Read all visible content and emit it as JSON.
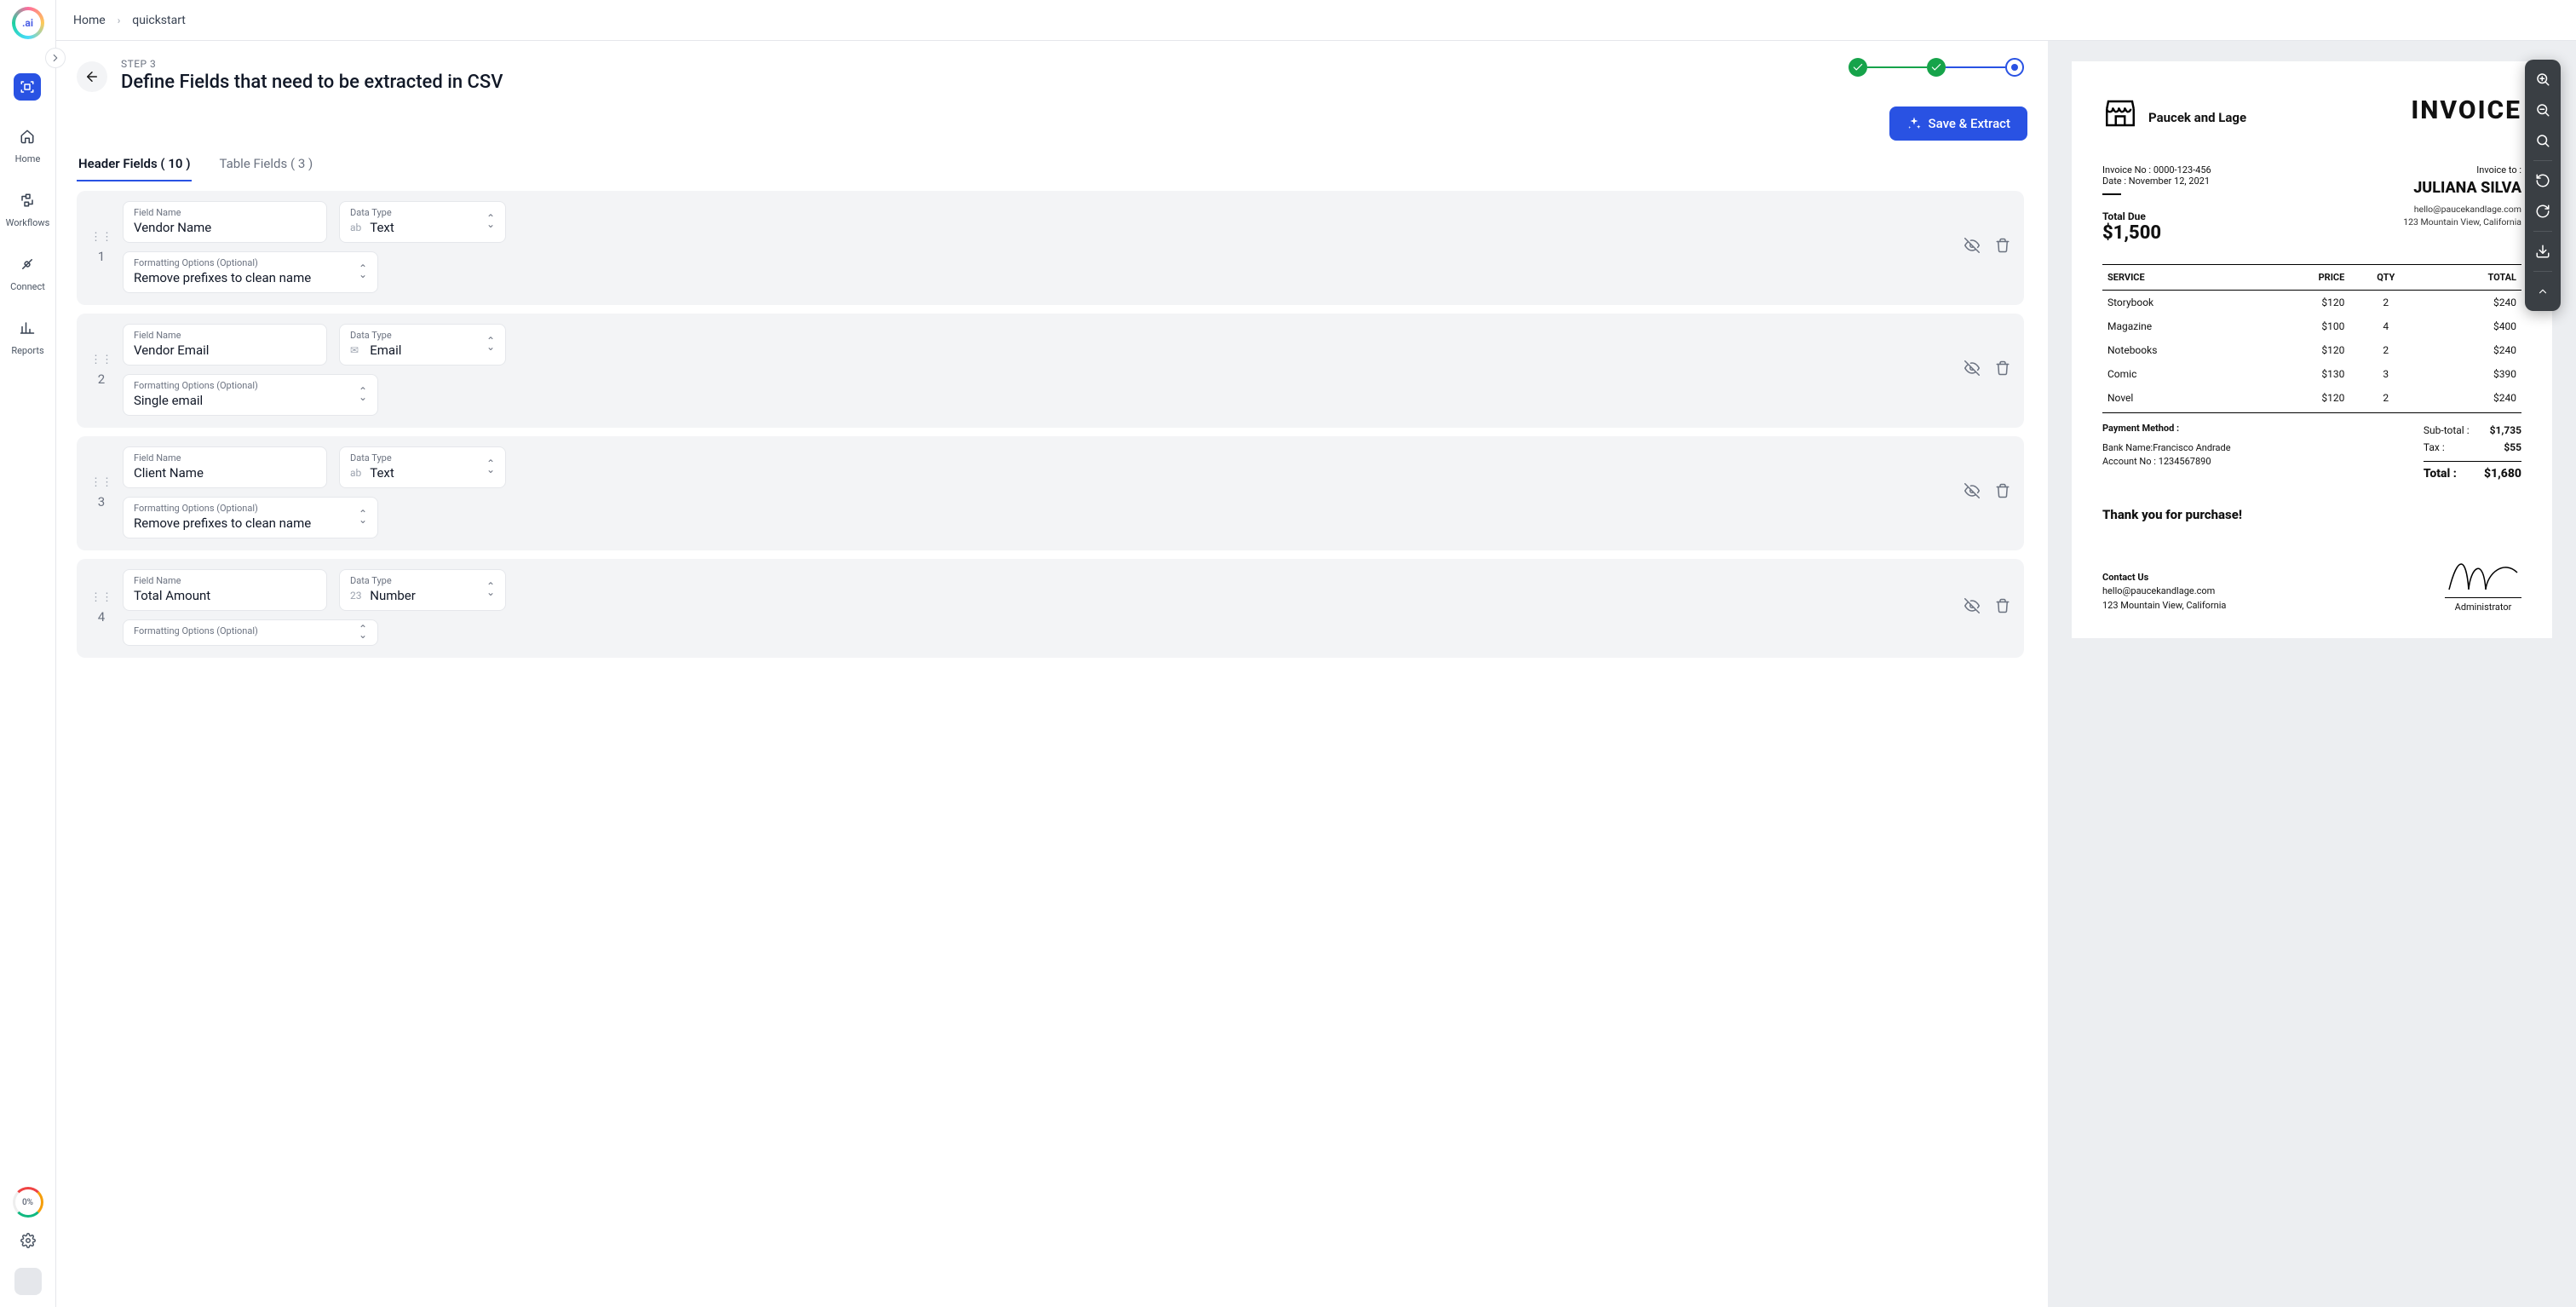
{
  "breadcrumb": {
    "home": "Home",
    "current": "quickstart"
  },
  "sidebar": {
    "items": [
      {
        "label": "Home"
      },
      {
        "label": "Workflows"
      },
      {
        "label": "Connect"
      },
      {
        "label": "Reports"
      }
    ],
    "progress_label": "0%"
  },
  "step": {
    "label": "STEP 3",
    "title": "Define Fields that need to be extracted in CSV"
  },
  "action_button": "Save & Extract",
  "tabs": {
    "header": "Header Fields ( 10 )",
    "table": "Table Fields ( 3 )"
  },
  "field_labels": {
    "name": "Field Name",
    "type": "Data Type",
    "fmt": "Formatting Options (Optional)"
  },
  "type_icons": {
    "Text": "ab",
    "Email": "✉",
    "Number": "23"
  },
  "fields": [
    {
      "idx": "1",
      "name": "Vendor Name",
      "type": "Text",
      "fmt": "Remove prefixes to clean name"
    },
    {
      "idx": "2",
      "name": "Vendor Email",
      "type": "Email",
      "fmt": "Single email"
    },
    {
      "idx": "3",
      "name": "Client Name",
      "type": "Text",
      "fmt": "Remove prefixes to clean name"
    },
    {
      "idx": "4",
      "name": "Total Amount",
      "type": "Number",
      "fmt": ""
    }
  ],
  "doc": {
    "vendor": "Paucek and Lage",
    "invoice_word": "INVOICE",
    "invoice_no_label": "Invoice No : ",
    "invoice_no": "0000-123-456",
    "date_label": "Date : ",
    "date": "November 12, 2021",
    "invoice_to": "Invoice to :",
    "client": "JULIANA SILVA",
    "client_email": "hello@paucekandlage.com",
    "client_addr": "123 Mountain View, California",
    "total_due_label": "Total Due",
    "total_due": "$1,500",
    "cols": {
      "service": "SERVICE",
      "price": "PRICE",
      "qty": "QTY",
      "total": "TOTAL"
    },
    "rows": [
      {
        "s": "Storybook",
        "p": "$120",
        "q": "2",
        "t": "$240"
      },
      {
        "s": "Magazine",
        "p": "$100",
        "q": "4",
        "t": "$400"
      },
      {
        "s": "Notebooks",
        "p": "$120",
        "q": "2",
        "t": "$240"
      },
      {
        "s": "Comic",
        "p": "$130",
        "q": "3",
        "t": "$390"
      },
      {
        "s": "Novel",
        "p": "$120",
        "q": "2",
        "t": "$240"
      }
    ],
    "pm_title": "Payment Method :",
    "pm_bank_label": "Bank Name:",
    "pm_bank": "Francisco Andrade",
    "pm_acct_label": "Account No : ",
    "pm_acct": "1234567890",
    "subtotal_label": "Sub-total :",
    "subtotal": "$1,735",
    "tax_label": "Tax :",
    "tax": "$55",
    "grand_label": "Total :",
    "grand": "$1,680",
    "thanks": "Thank you for purchase!",
    "contact_title": "Contact Us",
    "contact_email": "hello@paucekandlage.com",
    "contact_addr": "123 Mountain View, California",
    "sig_role": "Administrator"
  }
}
